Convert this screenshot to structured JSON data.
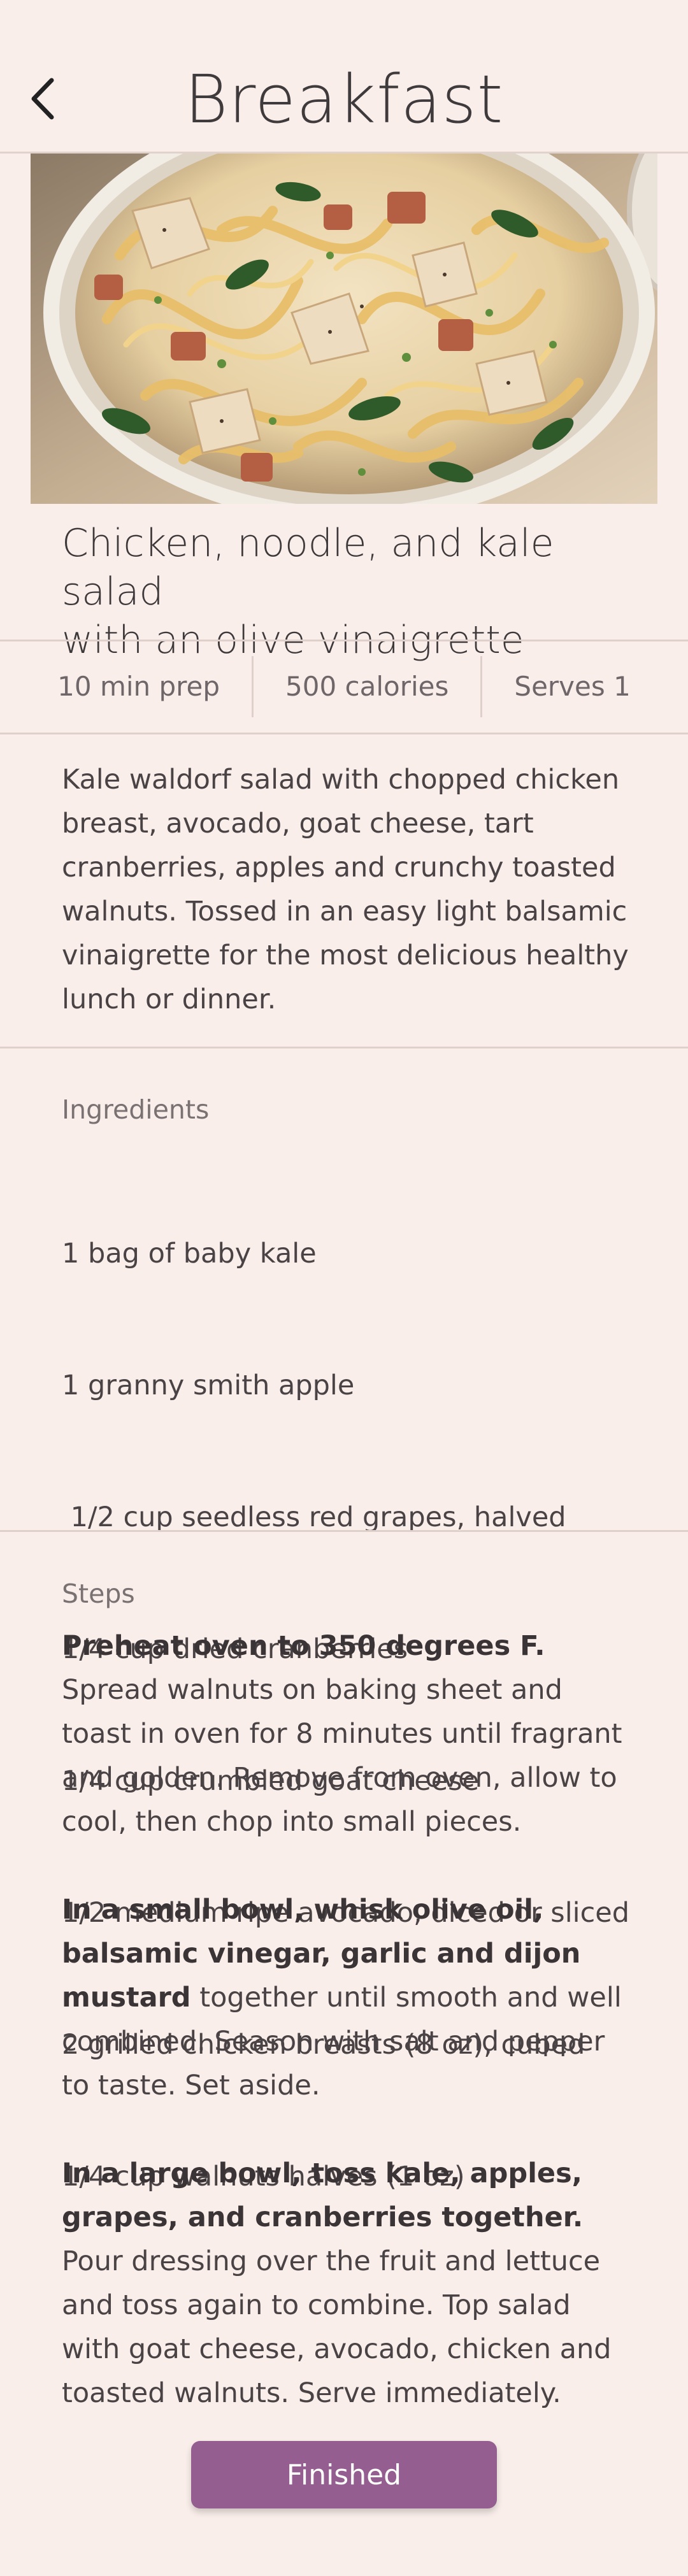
{
  "header": {
    "title": "Breakfast",
    "back_icon": "chevron-left-icon"
  },
  "recipe": {
    "title_line1": "Chicken, noodle, and kale salad",
    "title_line2": "with an olive vinaigrette",
    "stats": {
      "prep": "10 min prep",
      "calories": "500 calories",
      "serves": "Serves 1"
    },
    "description": "Kale waldorf salad with chopped chicken breast, avocado, goat cheese, tart cranberries, apples and crunchy toasted walnuts. Tossed in an easy light balsamic vinaigrette for the most delicious healthy lunch or dinner."
  },
  "ingredients": {
    "label": "Ingredients",
    "items": [
      "1 bag of baby kale",
      "1 granny smith apple",
      " 1/2 cup seedless red grapes, halved",
      "1/4 cup dried cranberries",
      "1/4 cup crumbled goat cheese",
      "1/2 medium ripe avocado, diced or sliced",
      "2 grilled chicken breasts (8 oz), cubed",
      "1/4 cup walnuts halves (1 oz)"
    ]
  },
  "steps": {
    "label": "Steps",
    "items": [
      {
        "bold": "Preheat oven to 350 degrees F.",
        "text": " Spread walnuts on baking sheet and toast in oven for 8 minutes until fragrant and golden. Remove from oven, allow to cool, then chop into small pieces."
      },
      {
        "bold": "In a small bowl, whisk olive oil, balsamic vinegar, garlic and dijon mustard",
        "text": " together until smooth and well combined. Season with salt and pepper to taste. Set aside."
      },
      {
        "bold": "In a large bowl, toss kale, apples, grapes, and cranberries together.",
        "text": " Pour dressing over the fruit and lettuce and toss again to combine. Top salad with goat cheese, avocado, chicken and toasted walnuts. Serve immediately."
      }
    ]
  },
  "footer": {
    "finished_label": "Finished",
    "accent_color": "#945e91"
  },
  "colors": {
    "background": "#f9eeea",
    "divider": "#e0d0cb"
  }
}
